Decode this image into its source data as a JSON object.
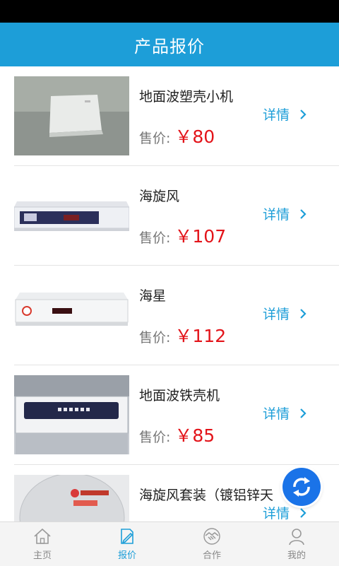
{
  "header": {
    "title": "产品报价"
  },
  "price_label": "售价:",
  "detail_label": "详情",
  "products": [
    {
      "name": "地面波塑壳小机",
      "price": "￥80"
    },
    {
      "name": "海旋风",
      "price": "￥107"
    },
    {
      "name": "海星",
      "price": "￥112"
    },
    {
      "name": "地面波铁壳机",
      "price": "￥85"
    },
    {
      "name": "海旋风套装（镀铝锌天",
      "price": ""
    }
  ],
  "tabs": [
    {
      "label": "主页",
      "icon": "home-icon",
      "active": false
    },
    {
      "label": "报价",
      "icon": "quote-icon",
      "active": true
    },
    {
      "label": "合作",
      "icon": "handshake-icon",
      "active": false
    },
    {
      "label": "我的",
      "icon": "user-icon",
      "active": false
    }
  ],
  "colors": {
    "accent": "#1d9ed8",
    "price": "#e3141a",
    "fab": "#1a73e8"
  }
}
